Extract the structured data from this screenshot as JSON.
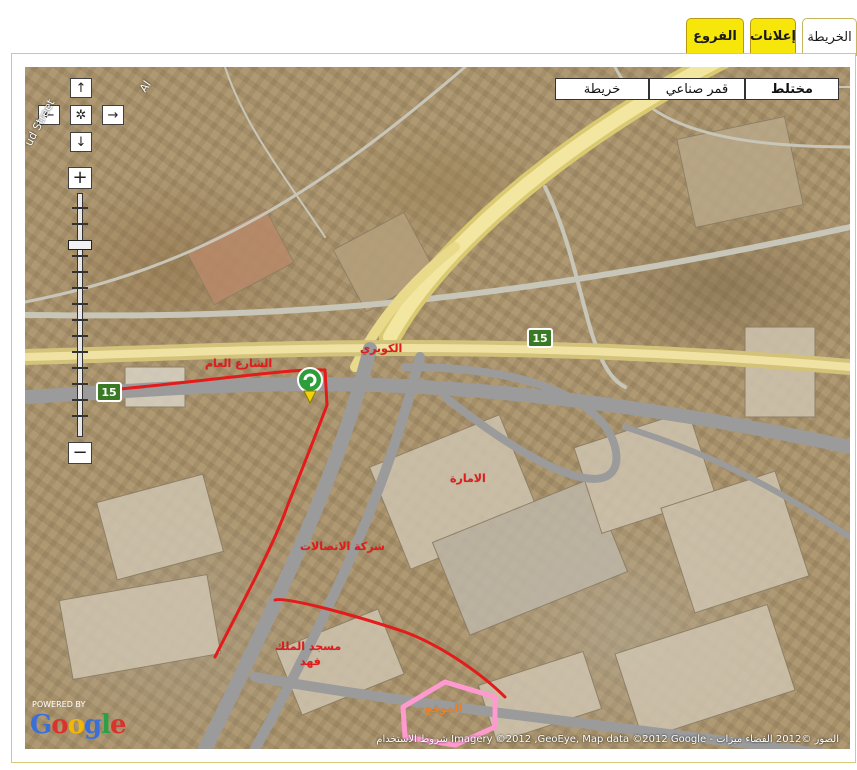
{
  "tabs": [
    {
      "label": "الخريطة",
      "active": true
    },
    {
      "label": "إعلانات",
      "active": false
    },
    {
      "label": "الفروع",
      "active": false
    }
  ],
  "controls": {
    "pan_up": "↑",
    "pan_left": "←",
    "pan_center": "✲",
    "pan_right": "→",
    "pan_down": "↓",
    "zoom_in": "+",
    "zoom_out": "−",
    "zoom_level_fraction": 0.8
  },
  "map_types": [
    {
      "label": "مختلط",
      "selected": true
    },
    {
      "label": "قمر صناعي",
      "selected": false
    },
    {
      "label": "خريطة",
      "selected": false
    }
  ],
  "annotations": {
    "main_street": "الشارع العام",
    "bridge": "الكوبري",
    "emirate": "الامارة",
    "telecom_company": "شركة الاتصالات",
    "mosque_line1": "مسجد الملك",
    "mosque_line2": "فهد",
    "location": "الموقع"
  },
  "road_shield": "15",
  "street_labels": {
    "street": "ud Street",
    "al": "Al"
  },
  "logo": {
    "powered_by": "POWERED BY",
    "letters": [
      "G",
      "o",
      "o",
      "g",
      "l",
      "e"
    ],
    "colors": [
      "#3b6fd8",
      "#d8342b",
      "#f2b705",
      "#3b6fd8",
      "#2f9e44",
      "#d8342b"
    ]
  },
  "attribution": "شروط الاستخدام  Imagery ©2012 ,GeoEye, Map data ©2012 Google - الصور ©2012 الفضاء  ميزات",
  "colors": {
    "tab_yellow": "#f6e60a",
    "route_red": "#e31b1b",
    "location_pink": "#ff9ad0"
  }
}
